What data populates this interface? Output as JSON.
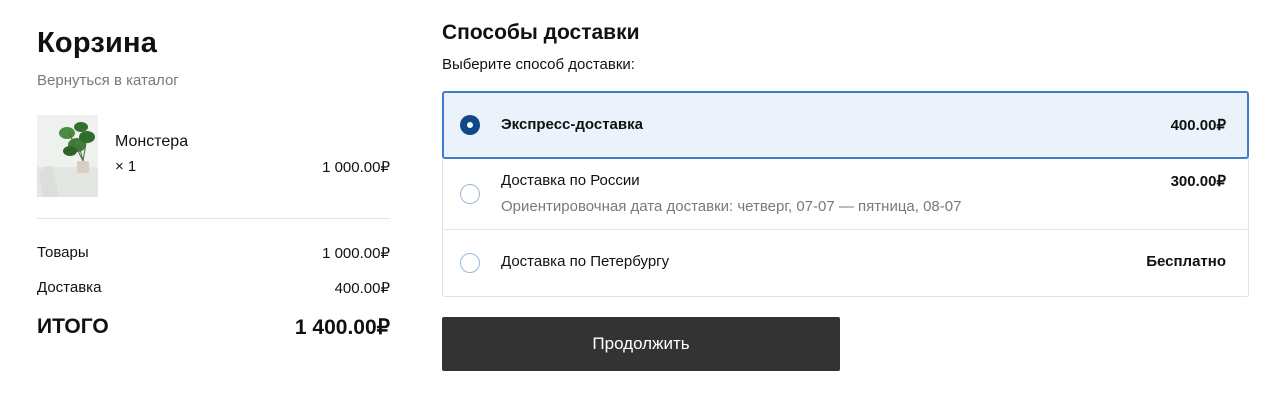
{
  "cart": {
    "title": "Корзина",
    "back_link": "Вернуться в каталог",
    "items": [
      {
        "name": "Монстера",
        "qty": "× 1",
        "price": "1 000.00₽",
        "image": "monstera-plant-photo"
      }
    ],
    "summary": {
      "goods_label": "Товары",
      "goods_value": "1 000.00₽",
      "delivery_label": "Доставка",
      "delivery_value": "400.00₽",
      "total_label": "ИТОГО",
      "total_value": "1 400.00₽"
    }
  },
  "delivery": {
    "title": "Способы доставки",
    "subtitle": "Выберите способ доставки:",
    "options": [
      {
        "name": "Экспресс-доставка",
        "price": "400.00₽",
        "selected": true
      },
      {
        "name": "Доставка по России",
        "eta": "Ориентировочная дата доставки: четверг, 07-07 — пятница, 08-07",
        "price": "300.00₽",
        "selected": false
      },
      {
        "name": "Доставка по Петербургу",
        "price": "Бесплатно",
        "selected": false
      }
    ],
    "continue_label": "Продолжить"
  },
  "colors": {
    "selected_bg": "#ebf2fb",
    "selected_border": "#3d7fc8",
    "radio_checked": "#0f4a86",
    "button_bg": "#333333"
  }
}
